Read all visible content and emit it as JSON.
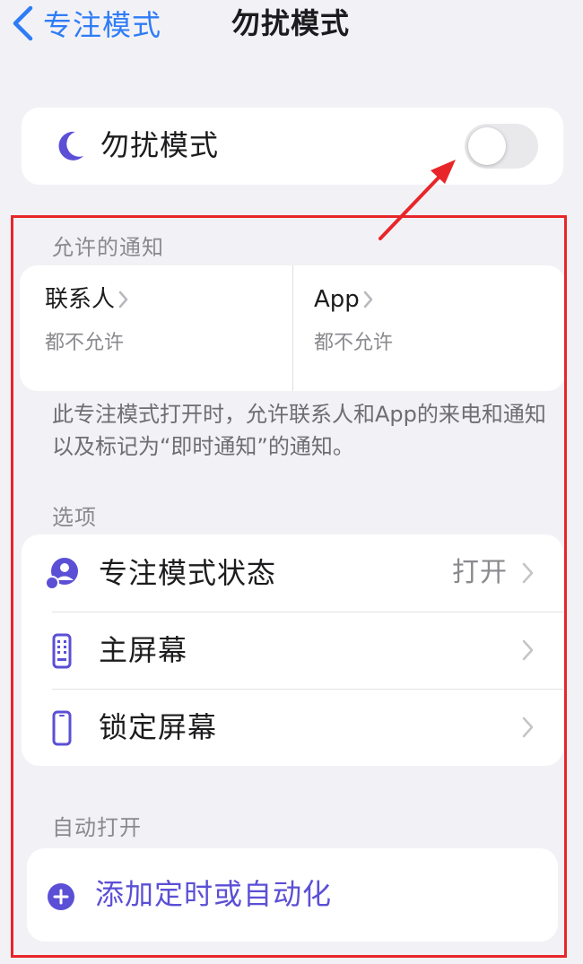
{
  "nav": {
    "back_label": "专注模式",
    "title": "勿扰模式"
  },
  "focus_toggle": {
    "label": "勿扰模式",
    "enabled": false
  },
  "allowed_notifications": {
    "header": "允许的通知",
    "contacts": {
      "title": "联系人",
      "value": "都不允许"
    },
    "apps": {
      "title": "App",
      "value": "都不允许"
    },
    "description": "此专注模式打开时，允许联系人和App的来电和通知以及标记为“即时通知”的通知。"
  },
  "options": {
    "header": "选项",
    "rows": [
      {
        "label": "专注模式状态",
        "value": "打开"
      },
      {
        "label": "主屏幕",
        "value": ""
      },
      {
        "label": "锁定屏幕",
        "value": ""
      }
    ]
  },
  "auto_on": {
    "header": "自动打开",
    "add_label": "添加定时或自动化"
  },
  "colors": {
    "accent_blue": "#2f7cf6",
    "accent_purple": "#5b4fd6",
    "annotation_red": "#e8262a",
    "background": "#f2f2f6"
  },
  "icons": {
    "back": "chevron-left-icon",
    "moon": "moon-icon",
    "focus_status": "focus-status-icon",
    "home_screen": "home-screen-icon",
    "lock_screen": "lock-screen-icon",
    "add": "plus-circle-icon"
  }
}
